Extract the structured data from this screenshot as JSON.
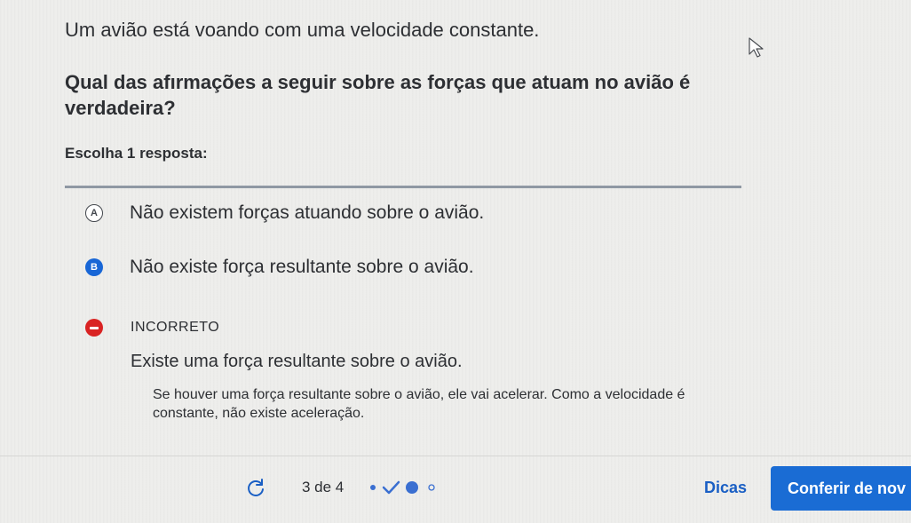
{
  "question": {
    "intro": "Um avião está voando com uma velocidade constante.",
    "text": "Qual das afırmações a seguir sobre as forças que atuam no avião é verdadeira?",
    "instruction": "Escolha 1 resposta:"
  },
  "options": [
    {
      "letter": "A",
      "label": "Não existem forças atuando sobre o avião.",
      "selected": false
    },
    {
      "letter": "B",
      "label": "Não existe força resultante sobre o avião.",
      "selected": true
    }
  ],
  "feedback": {
    "status": "INCORRETO",
    "title": "Existe uma força resultante sobre o avião.",
    "explanation": "Se houver uma força resultante sobre o avião, ele vai acelerar. Como a velocidade é constante, não existe aceleração."
  },
  "footer": {
    "reload_icon": "reload-icon",
    "progress": "3 de 4",
    "progress_dots": [
      "filled-dot",
      "check",
      "filled-dot-large",
      "empty-dot"
    ],
    "hints_label": "Dicas",
    "check_label": "Conferir de nov"
  },
  "colors": {
    "accent": "#1a6cd4",
    "error": "#d92323",
    "divider": "#8f98a3",
    "background": "#eeeeec"
  }
}
